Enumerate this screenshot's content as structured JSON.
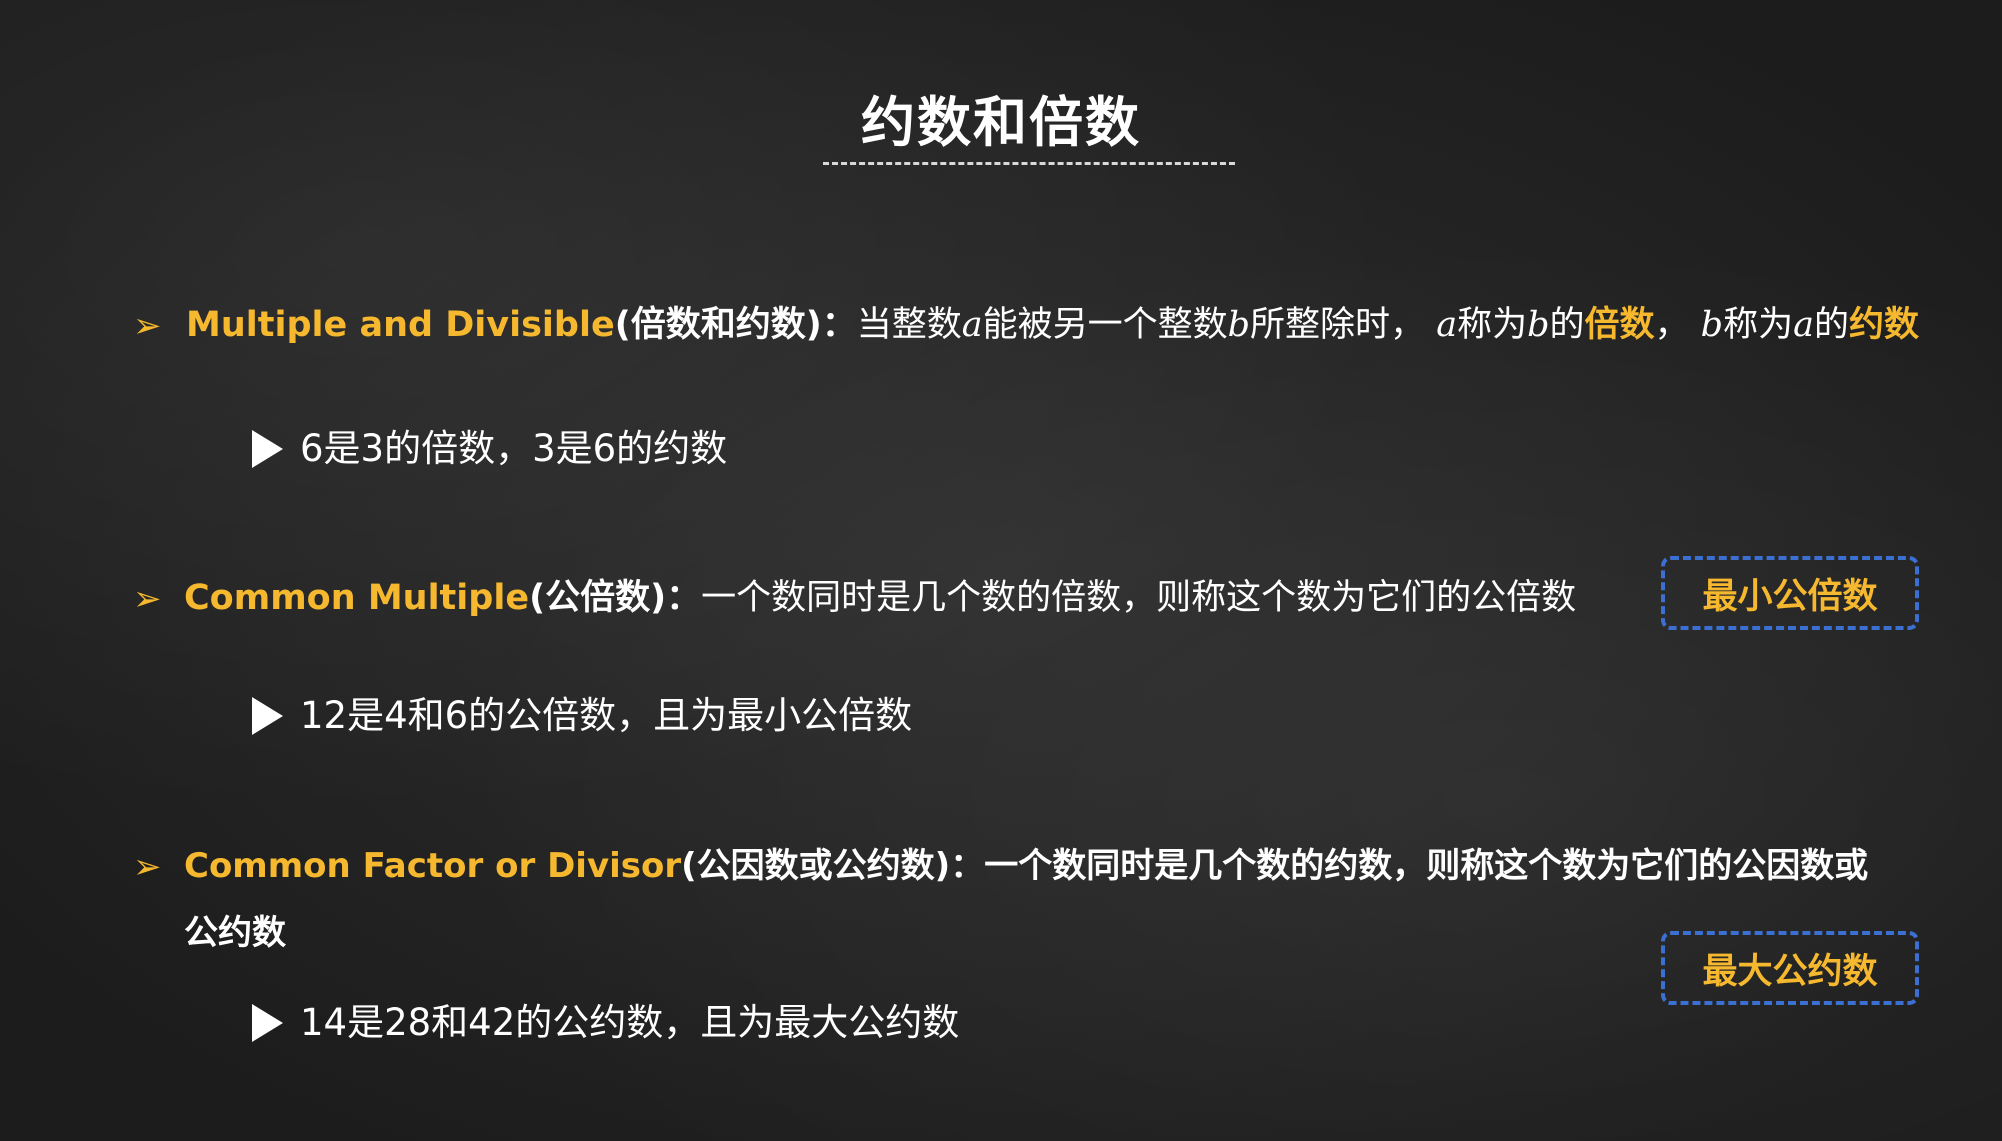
{
  "title": "约数和倍数",
  "items": [
    {
      "term": "Multiple and Divisible",
      "paren": "(倍数和约数)",
      "colon": "：",
      "t1": "当整数",
      "v1": "a",
      "t2": "能被另一个整数",
      "v2": "b",
      "t3": "所整除时，",
      "v3": "a",
      "t4": "称为",
      "v4": "b",
      "t5": "的",
      "h1": "倍数",
      "t6": "，",
      "v5": "b",
      "t7": "称为",
      "v6": "a",
      "t8": "的",
      "h2": "约数",
      "example": "6是3的倍数，3是6的约数"
    },
    {
      "term": "Common Multiple",
      "paren": "(公倍数)",
      "colon": "：",
      "definition": "一个数同时是几个数的倍数，则称这个数为它们的公倍数",
      "tag": "最小公倍数",
      "example": "12是4和6的公倍数，且为最小公倍数"
    },
    {
      "term": "Common Factor or Divisor",
      "paren": "(公因数或公约数)",
      "colon": "：",
      "definition": "一个数同时是几个数的约数，则称这个数为它们的公因数或",
      "definition_cont": "公约数",
      "tag": "最大公约数",
      "example": "14是28和42的公约数，且为最大公约数"
    }
  ],
  "bullet_glyph": "➢",
  "colors": {
    "accent": "#f5b82e",
    "tag_border": "#3b6fd1",
    "text": "#ffffff",
    "background": "#262626"
  }
}
